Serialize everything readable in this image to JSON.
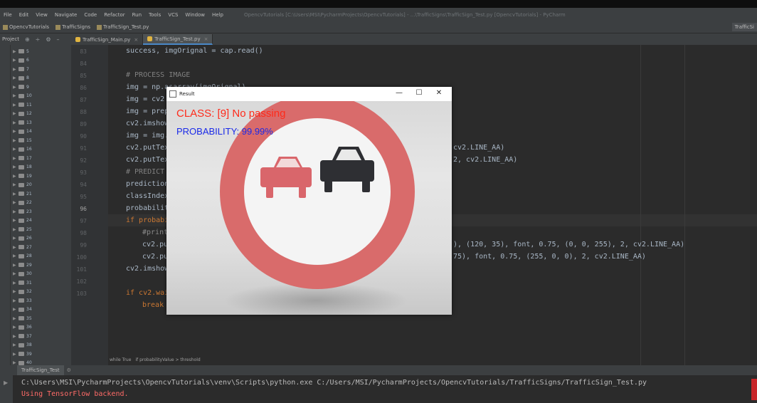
{
  "menu": {
    "items": [
      "File",
      "Edit",
      "View",
      "Navigate",
      "Code",
      "Refactor",
      "Run",
      "Tools",
      "VCS",
      "Window",
      "Help"
    ],
    "window_title": "OpencvTutorials [C:\\Users\\MSI\\PycharmProjects\\OpencvTutorials] - ...\\TrafficSigns\\TrafficSign_Test.py [OpencvTutorials] - PyCharm"
  },
  "navbar": {
    "crumbs": [
      "OpencvTutorials",
      "TrafficSigns",
      "TrafficSign_Test.py"
    ],
    "run_config": "TrafficSi"
  },
  "project_panel": {
    "label": "Project"
  },
  "tabs": [
    {
      "label": "TrafficSign_Main.py",
      "active": false
    },
    {
      "label": "TrafficSign_Test.py",
      "active": true
    }
  ],
  "project_tree": [
    "5",
    "6",
    "7",
    "8",
    "9",
    "10",
    "11",
    "12",
    "13",
    "14",
    "15",
    "16",
    "17",
    "18",
    "19",
    "20",
    "21",
    "22",
    "23",
    "24",
    "25",
    "26",
    "27",
    "28",
    "29",
    "30",
    "31",
    "32",
    "33",
    "34",
    "35",
    "36",
    "37",
    "38",
    "39",
    "40",
    "41"
  ],
  "line_numbers": [
    "83",
    "84",
    "85",
    "86",
    "87",
    "88",
    "89",
    "90",
    "91",
    "92",
    "93",
    "94",
    "95",
    "96",
    "97",
    "98",
    "99",
    "100",
    "101",
    "102",
    "103"
  ],
  "current_line": "96",
  "code": {
    "l83": "success, imgOrignal = cap.read()",
    "l85": "# PROCESS IMAGE",
    "l86": "img = np.asarray(imgOrignal)",
    "l87": "img = cv2",
    "l88": "img = prep",
    "l89": "cv2.imshow",
    "l90": "img = img.",
    "l91": "cv2.putTex",
    "l92": "cv2.putTex",
    "l93": "# PREDICT",
    "l94": "prediction",
    "l95": "classIndex",
    "l96": "probabilit",
    "l97": "if probabi",
    "l98": "#print",
    "l99": "cv2.pu",
    "l100": "cv2.pu",
    "l101": "cv2.imshow",
    "l103": "if cv2.wai",
    "l104": "break"
  },
  "code_right": {
    "r91": "cv2.LINE_AA)",
    "r92": "2, cv2.LINE_AA)",
    "r99": "), (120, 35), font, 0.75, (0, 0, 255), 2, cv2.LINE_AA)",
    "r100": "75), font, 0.75, (255, 0, 0), 2, cv2.LINE_AA)"
  },
  "editor_breadcrumbs": [
    "while True",
    "if probabilityValue > threshold"
  ],
  "run_panel": {
    "tab": "TrafficSign_Test"
  },
  "console": {
    "command": "C:\\Users\\MSI\\PycharmProjects\\OpencvTutorials\\venv\\Scripts\\python.exe C:/Users/MSI/PycharmProjects/OpencvTutorials/TrafficSigns/TrafficSign_Test.py",
    "stderr": "Using TensorFlow backend."
  },
  "result_window": {
    "title": "Result",
    "class_text": "CLASS:  [9] No passing",
    "probability_text": "PROBABILITY: 99.99%",
    "controls": [
      "—",
      "☐",
      "✕"
    ]
  },
  "colors": {
    "class_text": "#ff2a1a",
    "probability_text": "#1a2ae8",
    "sign_ring": "#d96b6b",
    "car_left": "#d9666b",
    "car_right": "#2e2f33"
  }
}
